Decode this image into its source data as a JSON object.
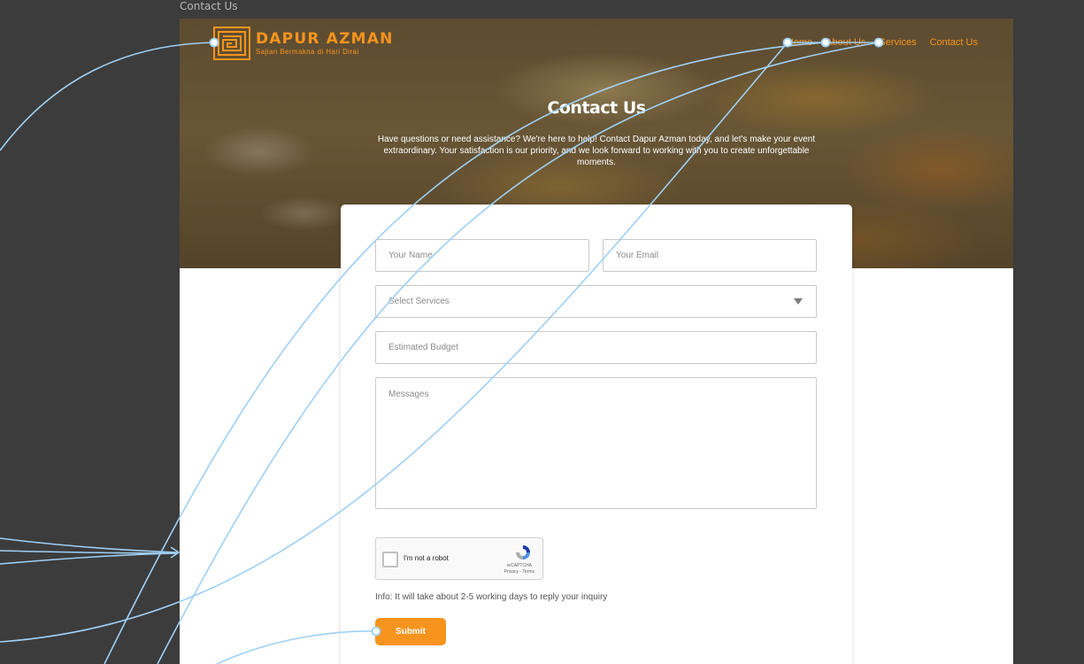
{
  "frame_label": "Contact Us",
  "brand": {
    "title": "DAPUR AZMAN",
    "tagline": "Sajian Bermakna di Hari Dirai"
  },
  "nav": {
    "home": "Home",
    "about": "About Us",
    "services": "Services",
    "contact": "Contact Us"
  },
  "hero": {
    "title": "Contact Us",
    "description": "Have questions or need assistance? We're here to help! Contact Dapur Azman today, and let's make your event extraordinary. Your satisfaction is our priority, and we look forward to working with you to create unforgettable moments."
  },
  "form": {
    "name_placeholder": "Your Name",
    "email_placeholder": "Your Email",
    "service_placeholder": "Select Services",
    "budget_placeholder": "Estimated Budget",
    "message_placeholder": "Messages",
    "captcha_label": "I'm not a robot",
    "captcha_brand": "reCAPTCHA",
    "captcha_links": "Privacy - Terms",
    "info": "Info: It will take about 2-5 working days to reply your inquiry",
    "submit_label": "Submit"
  },
  "colors": {
    "accent": "#f7941d",
    "canvas": "#3c3c3c",
    "wire": "#9fd0f5"
  }
}
